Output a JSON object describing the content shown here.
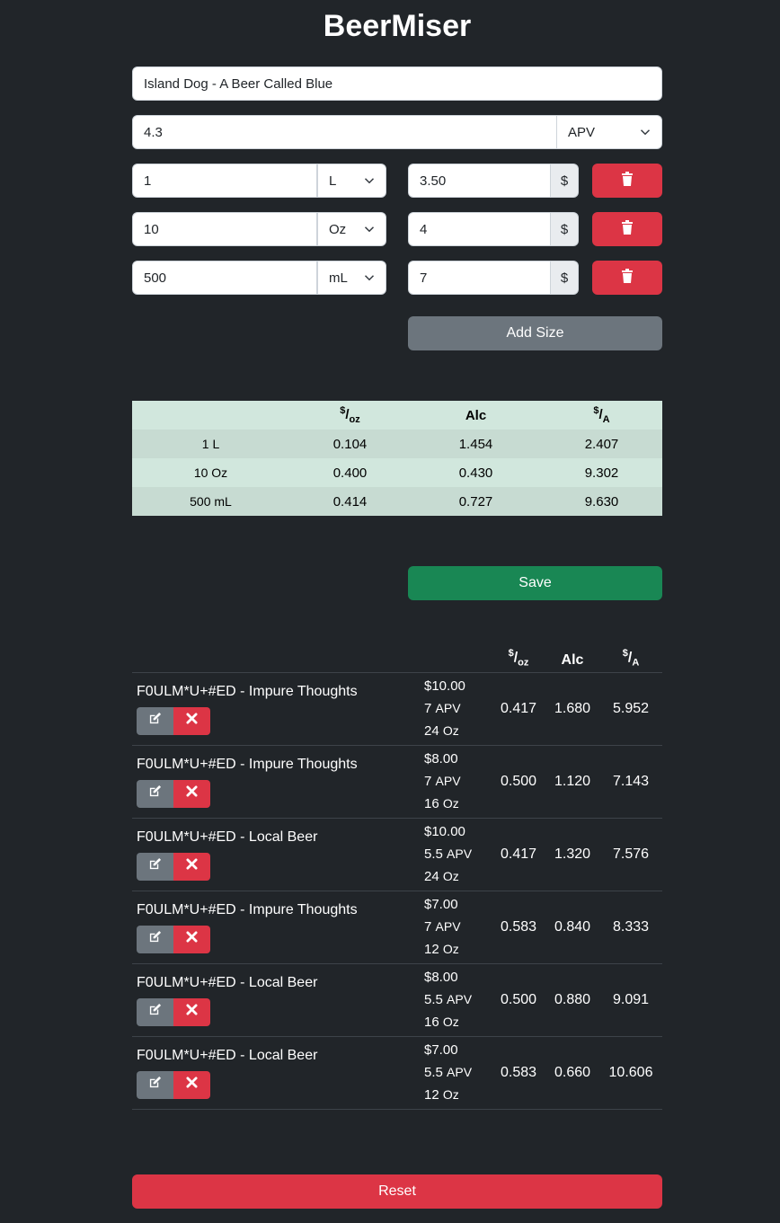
{
  "app": {
    "title": "BeerMiser"
  },
  "form": {
    "name_value": "Island Dog - A Beer Called Blue",
    "abv_value": "4.3",
    "abv_unit": "APV",
    "sizes": [
      {
        "volume": "1",
        "unit": "L",
        "price": "3.50",
        "currency": "$"
      },
      {
        "volume": "10",
        "unit": "Oz",
        "price": "4",
        "currency": "$"
      },
      {
        "volume": "500",
        "unit": "mL",
        "price": "7",
        "currency": "$"
      }
    ],
    "add_size_label": "Add Size",
    "save_label": "Save",
    "reset_label": "Reset"
  },
  "calc_table": {
    "headers": {
      "per_oz_sup": "$",
      "per_oz_sub": "oz",
      "alc": "Alc",
      "per_a_sup": "$",
      "per_a_sub": "A"
    },
    "rows": [
      {
        "size": "1 L",
        "per_oz": "0.104",
        "alc": "1.454",
        "per_a": "2.407"
      },
      {
        "size": "10 Oz",
        "per_oz": "0.400",
        "alc": "0.430",
        "per_a": "9.302"
      },
      {
        "size": "500 mL",
        "per_oz": "0.414",
        "alc": "0.727",
        "per_a": "9.630"
      }
    ]
  },
  "saved_table": {
    "headers": {
      "per_oz_sup": "$",
      "per_oz_sub": "oz",
      "alc": "Alc",
      "per_a_sup": "$",
      "per_a_sub": "A"
    },
    "rows": [
      {
        "name": "F0ULM*U+#ED - Impure Thoughts",
        "price": "$10.00",
        "abv": "7",
        "abv_unit": "APV",
        "size": "24",
        "size_unit": "Oz",
        "per_oz": "0.417",
        "alc": "1.680",
        "per_a": "5.952"
      },
      {
        "name": "F0ULM*U+#ED - Impure Thoughts",
        "price": "$8.00",
        "abv": "7",
        "abv_unit": "APV",
        "size": "16",
        "size_unit": "Oz",
        "per_oz": "0.500",
        "alc": "1.120",
        "per_a": "7.143"
      },
      {
        "name": "F0ULM*U+#ED - Local Beer",
        "price": "$10.00",
        "abv": "5.5",
        "abv_unit": "APV",
        "size": "24",
        "size_unit": "Oz",
        "per_oz": "0.417",
        "alc": "1.320",
        "per_a": "7.576"
      },
      {
        "name": "F0ULM*U+#ED - Impure Thoughts",
        "price": "$7.00",
        "abv": "7",
        "abv_unit": "APV",
        "size": "12",
        "size_unit": "Oz",
        "per_oz": "0.583",
        "alc": "0.840",
        "per_a": "8.333"
      },
      {
        "name": "F0ULM*U+#ED - Local Beer",
        "price": "$8.00",
        "abv": "5.5",
        "abv_unit": "APV",
        "size": "16",
        "size_unit": "Oz",
        "per_oz": "0.500",
        "alc": "0.880",
        "per_a": "9.091"
      },
      {
        "name": "F0ULM*U+#ED - Local Beer",
        "price": "$7.00",
        "abv": "5.5",
        "abv_unit": "APV",
        "size": "12",
        "size_unit": "Oz",
        "per_oz": "0.583",
        "alc": "0.660",
        "per_a": "10.606"
      }
    ]
  },
  "icons": {
    "trash": "trash-icon",
    "edit": "edit-icon",
    "close": "close-icon",
    "chevron": "chevron-down-icon"
  },
  "colors": {
    "danger": "#dc3545",
    "success": "#198754",
    "secondary": "#6c757d",
    "table_bg": "#d1e7dd",
    "page_bg": "#212529"
  }
}
